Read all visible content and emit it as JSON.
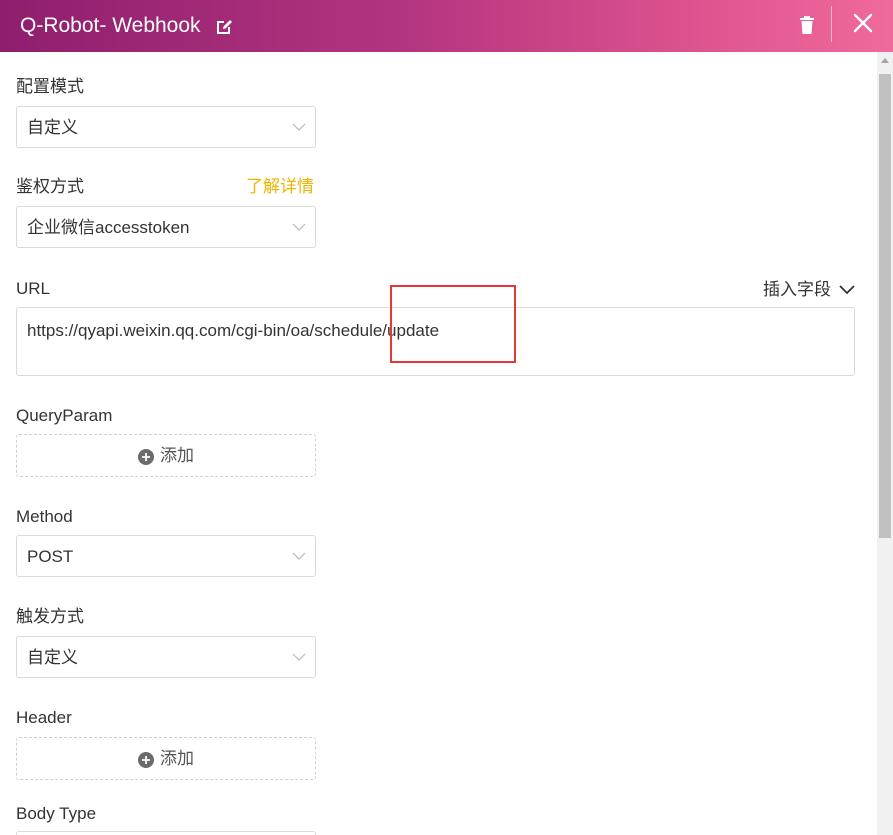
{
  "header": {
    "title": "Q-Robot- Webhook",
    "edit_icon": "edit-icon",
    "delete_icon": "trash-icon",
    "close_icon": "close-icon",
    "gradient": [
      "#8e1f6e",
      "#ef6a9c"
    ]
  },
  "config_mode": {
    "label": "配置模式",
    "value": "自定义"
  },
  "auth": {
    "label": "鉴权方式",
    "link": "了解详情",
    "value": "企业微信accesstoken",
    "link_color": "#f0b400"
  },
  "url": {
    "label": "URL",
    "insert_field": "插入字段",
    "value": "https://qyapi.weixin.qq.com/cgi-bin/oa/schedule/update"
  },
  "query_param": {
    "label": "QueryParam",
    "add": "添加"
  },
  "method": {
    "label": "Method",
    "value": "POST"
  },
  "trigger": {
    "label": "触发方式",
    "value": "自定义"
  },
  "header_section": {
    "label": "Header",
    "add": "添加"
  },
  "body_type": {
    "label": "Body Type"
  },
  "highlight_color": "#e53935"
}
